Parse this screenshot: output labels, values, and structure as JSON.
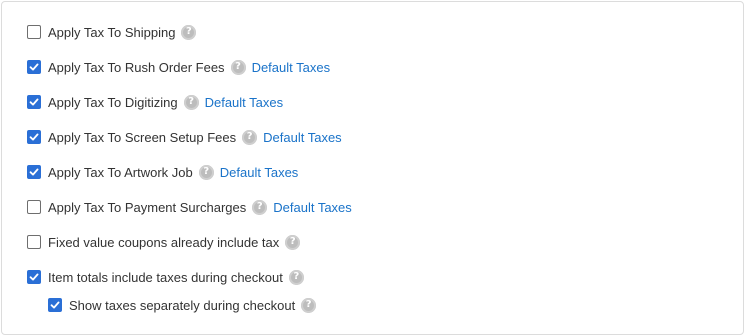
{
  "help_glyph": "?",
  "options": [
    {
      "label": "Apply Tax To Shipping",
      "checked": false,
      "link": ""
    },
    {
      "label": "Apply Tax To Rush Order Fees",
      "checked": true,
      "link": "Default Taxes"
    },
    {
      "label": "Apply Tax To Digitizing",
      "checked": true,
      "link": "Default Taxes"
    },
    {
      "label": "Apply Tax To Screen Setup Fees",
      "checked": true,
      "link": "Default Taxes"
    },
    {
      "label": "Apply Tax To Artwork Job",
      "checked": true,
      "link": "Default Taxes"
    },
    {
      "label": "Apply Tax To Payment Surcharges",
      "checked": false,
      "link": "Default Taxes"
    },
    {
      "label": "Fixed value coupons already include tax",
      "checked": false,
      "link": ""
    },
    {
      "label": "Item totals include taxes during checkout",
      "checked": true,
      "link": ""
    },
    {
      "label": "Show taxes separately during checkout",
      "checked": true,
      "link": ""
    }
  ],
  "colors": {
    "accent": "#2a6fd6",
    "link": "#1a73c9",
    "help_icon": "#bdbdbd",
    "border": "#dcdcdc",
    "text": "#333333"
  }
}
